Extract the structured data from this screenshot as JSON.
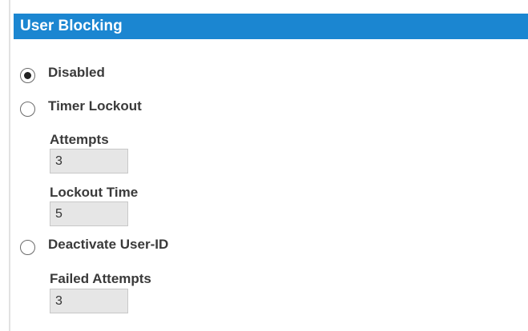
{
  "header": {
    "title": "User Blocking",
    "color": "#1b86d1"
  },
  "options": [
    {
      "label": "Disabled",
      "selected": true
    },
    {
      "label": "Timer Lockout",
      "selected": false
    },
    {
      "label": "Deactivate User-ID",
      "selected": false
    }
  ],
  "timer_lockout": {
    "attempts_label": "Attempts",
    "attempts_value": "3",
    "lockout_time_label": "Lockout Time",
    "lockout_time_value": "5"
  },
  "deactivate": {
    "failed_attempts_label": "Failed Attempts",
    "failed_attempts_value": "3"
  }
}
